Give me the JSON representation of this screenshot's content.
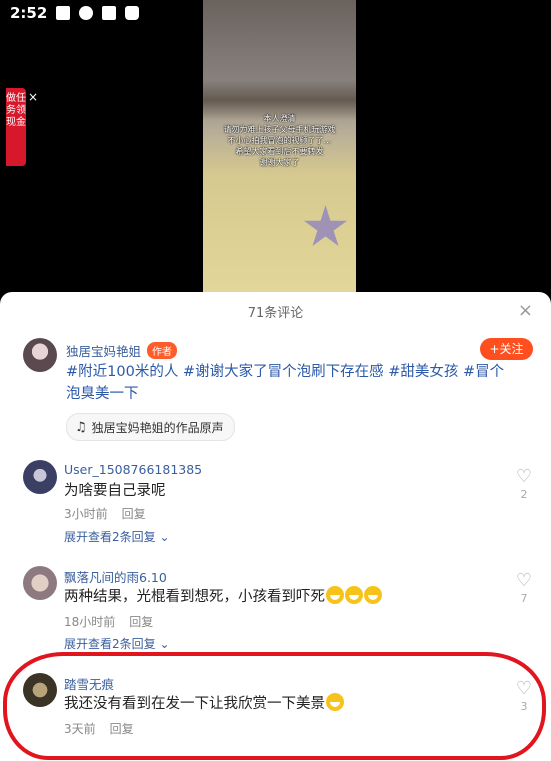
{
  "status_bar": {
    "time": "2:52",
    "icons": [
      "a-icon",
      "shield-icon",
      "photo-icon",
      "bag-icon"
    ]
  },
  "video": {
    "caption_lines": [
      "本人澄清",
      "请勿为难上孩子父母手机玩游戏",
      "不小心拍我冒泡的视频了了…",
      "希望大家看到后不要转发",
      "谢谢大家了"
    ]
  },
  "task_badge": {
    "label": "做任务领现金",
    "close": "×"
  },
  "sheet": {
    "title": "71条评论",
    "close": "×"
  },
  "post": {
    "author": "独居宝妈艳姐",
    "author_tag": "作者",
    "follow_label": "+关注",
    "text": "#附近100米的人 #谢谢大家了冒个泡刷下存在感 #甜美女孩 #冒个泡臭美一下",
    "sound_label": "独居宝妈艳姐的作品原声"
  },
  "comments": [
    {
      "user": "User_1508766181385",
      "text": "为啥要自己录呢",
      "time": "3小时前",
      "reply": "回复",
      "expand": "展开查看2条回复",
      "likes": "2"
    },
    {
      "user": "飘落凡间的雨6.10",
      "text": "两种结果，光棍看到想死，小孩看到吓死",
      "time": "18小时前",
      "reply": "回复",
      "expand": "展开查看2条回复",
      "likes": "7"
    },
    {
      "user": "踏雪无痕",
      "text": "我还没有看到在发一下让我欣赏一下美景",
      "time": "3天前",
      "reply": "回复",
      "likes": "3"
    }
  ],
  "colors": {
    "accent": "#ff4f1f",
    "link": "#2c5aa8",
    "annotation": "#e0151d"
  }
}
